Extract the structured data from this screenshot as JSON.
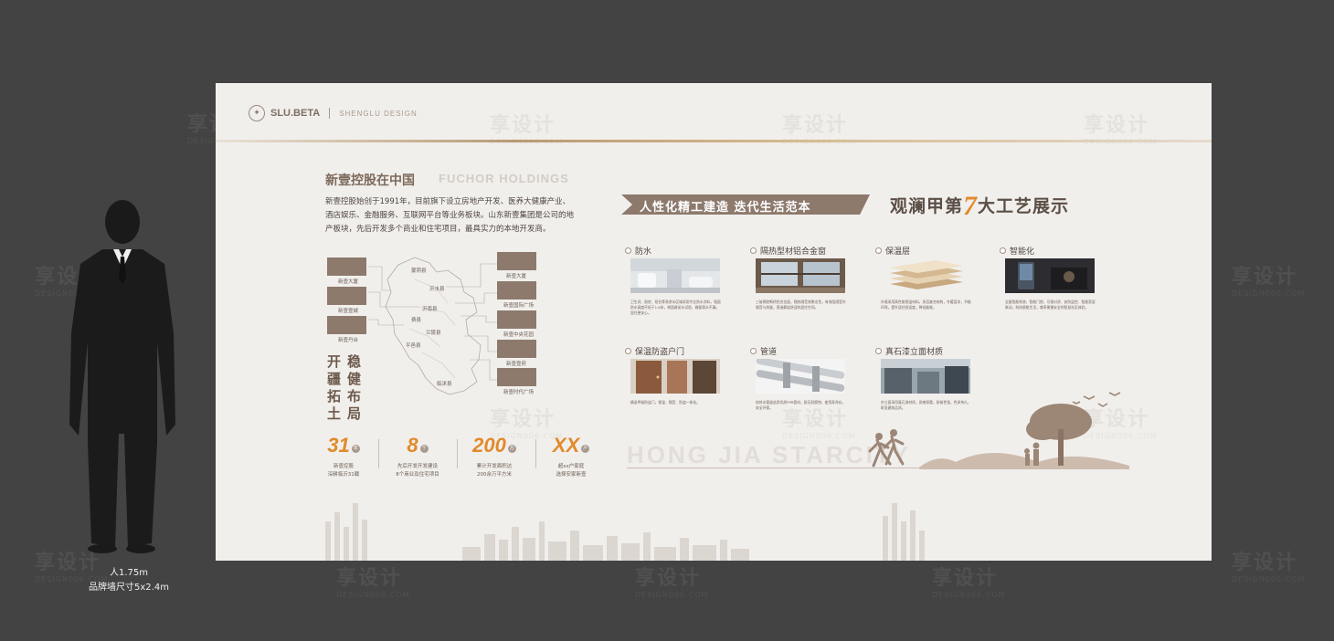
{
  "watermarks": {
    "brand": "享设计",
    "domain": "DESIGN006.COM"
  },
  "human_caption": {
    "height": "人1.75m",
    "wall_size": "品牌墙尺寸5x2.4m"
  },
  "board": {
    "logo": {
      "brand": "SLU.BETA",
      "sub": "SHENGLU DESIGN"
    },
    "intro": {
      "title": "新壹控股在中国",
      "title_en": "FUCHOR HOLDINGS",
      "paragraph": "新壹控股始创于1991年，目前旗下设立房地产开发、医养大健康产业、酒店娱乐、金融服务、互联网平台等业务板块。山东新壹集团是公司的地产板块，先后开发多个商业和住宅项目，最具实力的本地开发商。"
    },
    "map": {
      "left_labels": [
        "新壹大厦",
        "新壹壹城",
        "新壹丹台"
      ],
      "right_labels": [
        "新壹大厦",
        "新壹国际广场",
        "新壹中央花园",
        "新壹壹府",
        "新壹时代广场"
      ],
      "region_labels": [
        "蒙阴县",
        "沂水县",
        "沂南县",
        "兰陵县",
        "费县",
        "平邑县",
        "临沭县"
      ]
    },
    "slogans": {
      "col1": [
        "开",
        "疆",
        "拓",
        "土"
      ],
      "col2": [
        "稳",
        "健",
        "布",
        "局"
      ]
    },
    "stats": [
      {
        "num": "31",
        "unit": "年",
        "desc_line1": "新壹控股",
        "desc_line2": "深耕临沂31载"
      },
      {
        "num": "8",
        "unit": "个",
        "desc_line1": "先后开发开发建设",
        "desc_line2": "8个商业及住宅项目"
      },
      {
        "num": "200",
        "unit": "万",
        "desc_line1": "累计开发面积达",
        "desc_line2": "200余万平方米"
      },
      {
        "num": "XX",
        "unit": "户",
        "desc_line1": "超xx户家庭",
        "desc_line2": "选择安家新壹"
      }
    ],
    "banner": "人性化精工建造 迭代生活范本",
    "craft_title": {
      "before": "观澜甲第",
      "number": "7",
      "after": "大工艺展示"
    },
    "features": [
      {
        "title": "防水",
        "image": "bathroom-image",
        "text": "卫生间、厨房、阳台等易渗水区域采用专业防水涂料，墙面防水高度不低于1.8米，地面做闭水试验，确保滴水不漏，居住更安心。"
      },
      {
        "title": "隔热型材铝合金窗",
        "image": "window-image",
        "text": "三玻两腔断桥铝合金窗，隔热隔音效果出色，有效阻隔室外噪音与热量，营造静谧舒适的居住空间。"
      },
      {
        "title": "保温层",
        "image": "insulation-layers-image",
        "text": "外墙采用高性能保温材料，多层复合结构，冬暖夏凉，节能环保，提升居住舒适度，降低能耗。"
      },
      {
        "title": "智能化",
        "image": "smart-device-image",
        "text": "全屋智能系统，智能门锁、可视对讲、安防监控、智能家居联动，科技赋能生活，尊享便捷安全的智慧社区体验。"
      },
      {
        "title": "保温防盗户门",
        "image": "door-image",
        "text": "精选甲级防盗门，保温、隔音、防盗一体化。"
      },
      {
        "title": "管道",
        "image": "pipe-image",
        "text": "给排水管道选用优质PPR管材，耐压耐腐蚀，使用寿命长，安全环保。"
      },
      {
        "title": "真石漆立面材质",
        "image": "facade-image",
        "text": "外立面采用真石漆材质，质感厚重，耐候性强，色泽持久，彰显建筑品质。"
      }
    ],
    "wordmark": "HONG JIA STARCITY"
  }
}
